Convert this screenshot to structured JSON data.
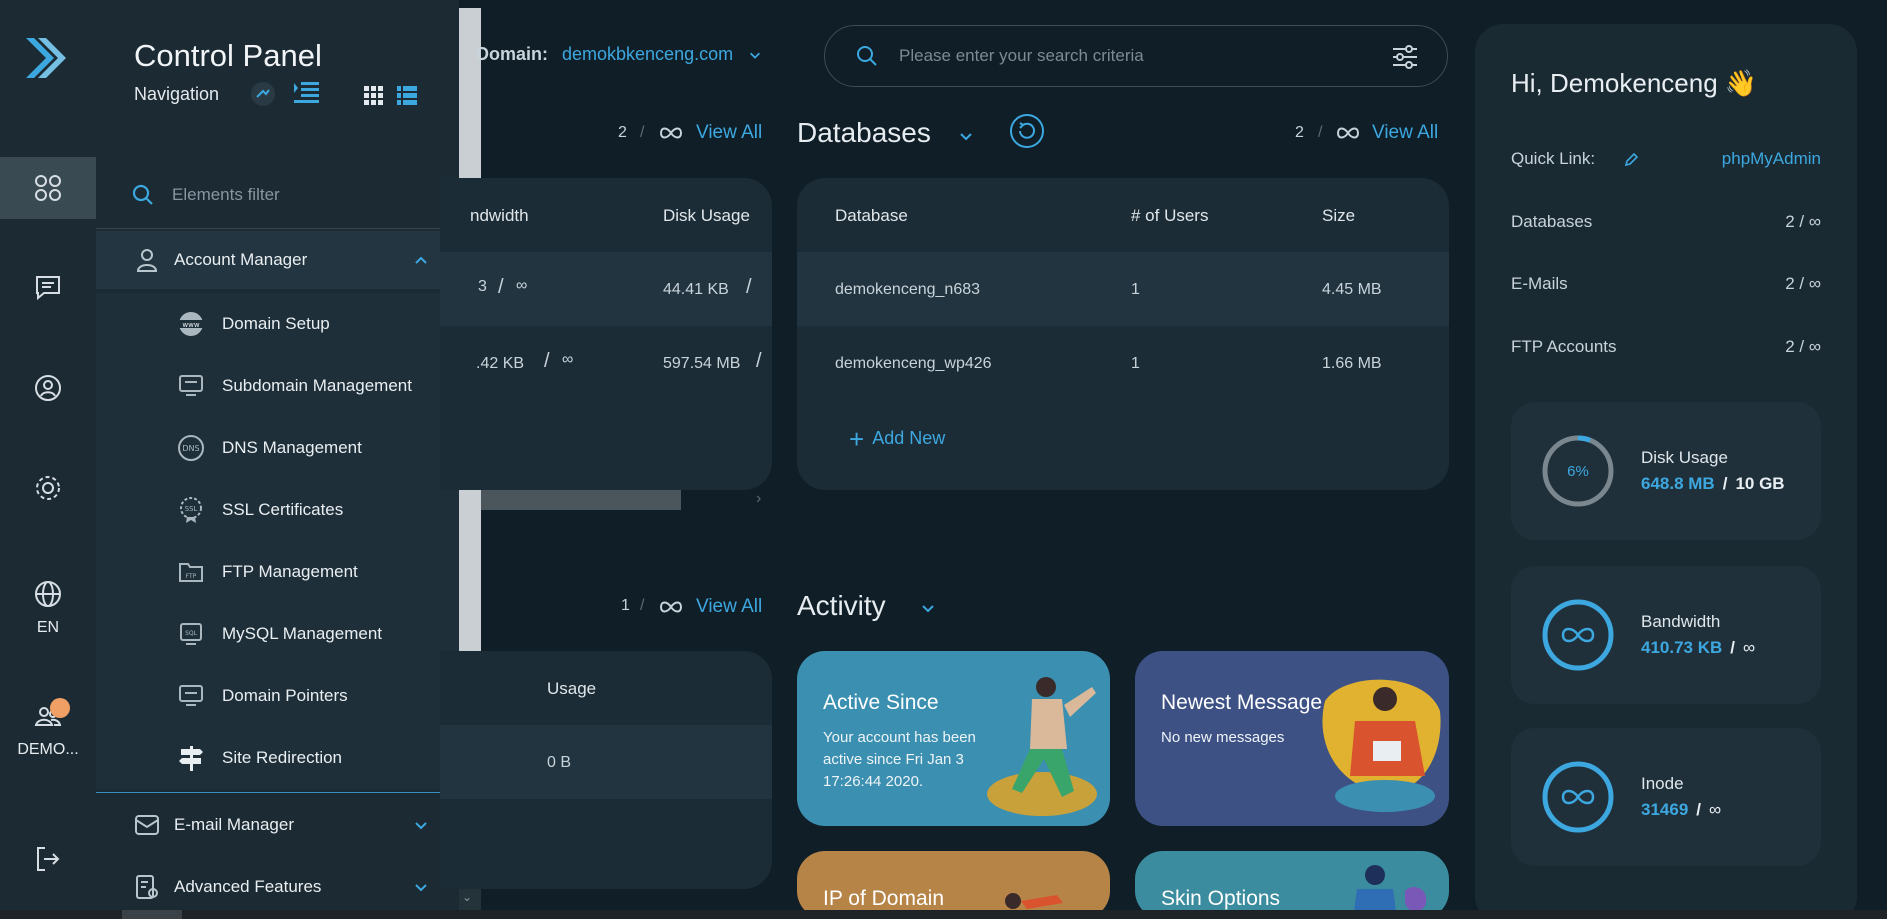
{
  "app": {
    "title": "Control Panel",
    "subtitle": "Navigation",
    "filter_placeholder": "Elements filter"
  },
  "rail": {
    "language": "EN",
    "user": "DEMO..."
  },
  "nav": {
    "account_manager": "Account Manager",
    "items": [
      "Domain Setup",
      "Subdomain Management",
      "DNS Management",
      "SSL Certificates",
      "FTP Management",
      "MySQL Management",
      "Domain Pointers",
      "Site Redirection"
    ],
    "email_manager": "E-mail Manager",
    "advanced_features": "Advanced Features"
  },
  "topbar": {
    "domain_label": "Domain:",
    "domain_value": "demokbkenceng.com",
    "search_placeholder": "Please enter your search criteria"
  },
  "left_card": {
    "count": "2",
    "slash": "/",
    "view_all": "View All",
    "col_bandwidth": "ndwidth",
    "col_disk": "Disk Usage",
    "rows": [
      {
        "bandwidth": "3",
        "disk": "44.41 KB"
      },
      {
        "bandwidth": ".42 KB",
        "disk": "597.54 MB"
      }
    ],
    "row_sep": "/"
  },
  "databases": {
    "title": "Databases",
    "count": "2",
    "slash": "/",
    "view_all": "View All",
    "col_db": "Database",
    "col_users": "# of Users",
    "col_size": "Size",
    "rows": [
      {
        "name": "demokenceng_n683",
        "users": "1",
        "size": "4.45 MB"
      },
      {
        "name": "demokenceng_wp426",
        "users": "1",
        "size": "1.66 MB"
      }
    ],
    "add_new": "Add New"
  },
  "lower_left_card": {
    "count": "1",
    "slash": "/",
    "view_all": "View All",
    "col_usage": "Usage",
    "usage_value": "0 B"
  },
  "activity": {
    "title": "Activity",
    "tiles": [
      {
        "title": "Active Since",
        "desc": "Your account has been active since Fri Jan 3 17:26:44 2020."
      },
      {
        "title": "Newest Message",
        "desc": "No new messages"
      },
      {
        "title": "IP of Domain",
        "desc": ""
      },
      {
        "title": "Skin Options",
        "desc": ""
      }
    ]
  },
  "right": {
    "greeting": "Hi, Demokenceng 👋",
    "quick_link_label": "Quick Link:",
    "quick_link_value": "phpMyAdmin",
    "databases_label": "Databases",
    "databases_value": "2 / ∞",
    "emails_label": "E-Mails",
    "emails_value": "2 / ∞",
    "ftp_label": "FTP Accounts",
    "ftp_value": "2 / ∞",
    "disk": {
      "label": "Disk Usage",
      "used": "648.8 MB",
      "max": "10 GB",
      "percent_text": "6%",
      "percent": 6
    },
    "bandwidth": {
      "label": "Bandwidth",
      "used": "410.73 KB",
      "max": "∞"
    },
    "inode": {
      "label": "Inode",
      "used": "31469",
      "max": "∞"
    },
    "stat_sep": "/"
  },
  "colors": {
    "accent": "#3da8e0",
    "rail_bg": "#1b2a33",
    "page_bg": "#0f1e27",
    "notification": "#f0a064"
  }
}
